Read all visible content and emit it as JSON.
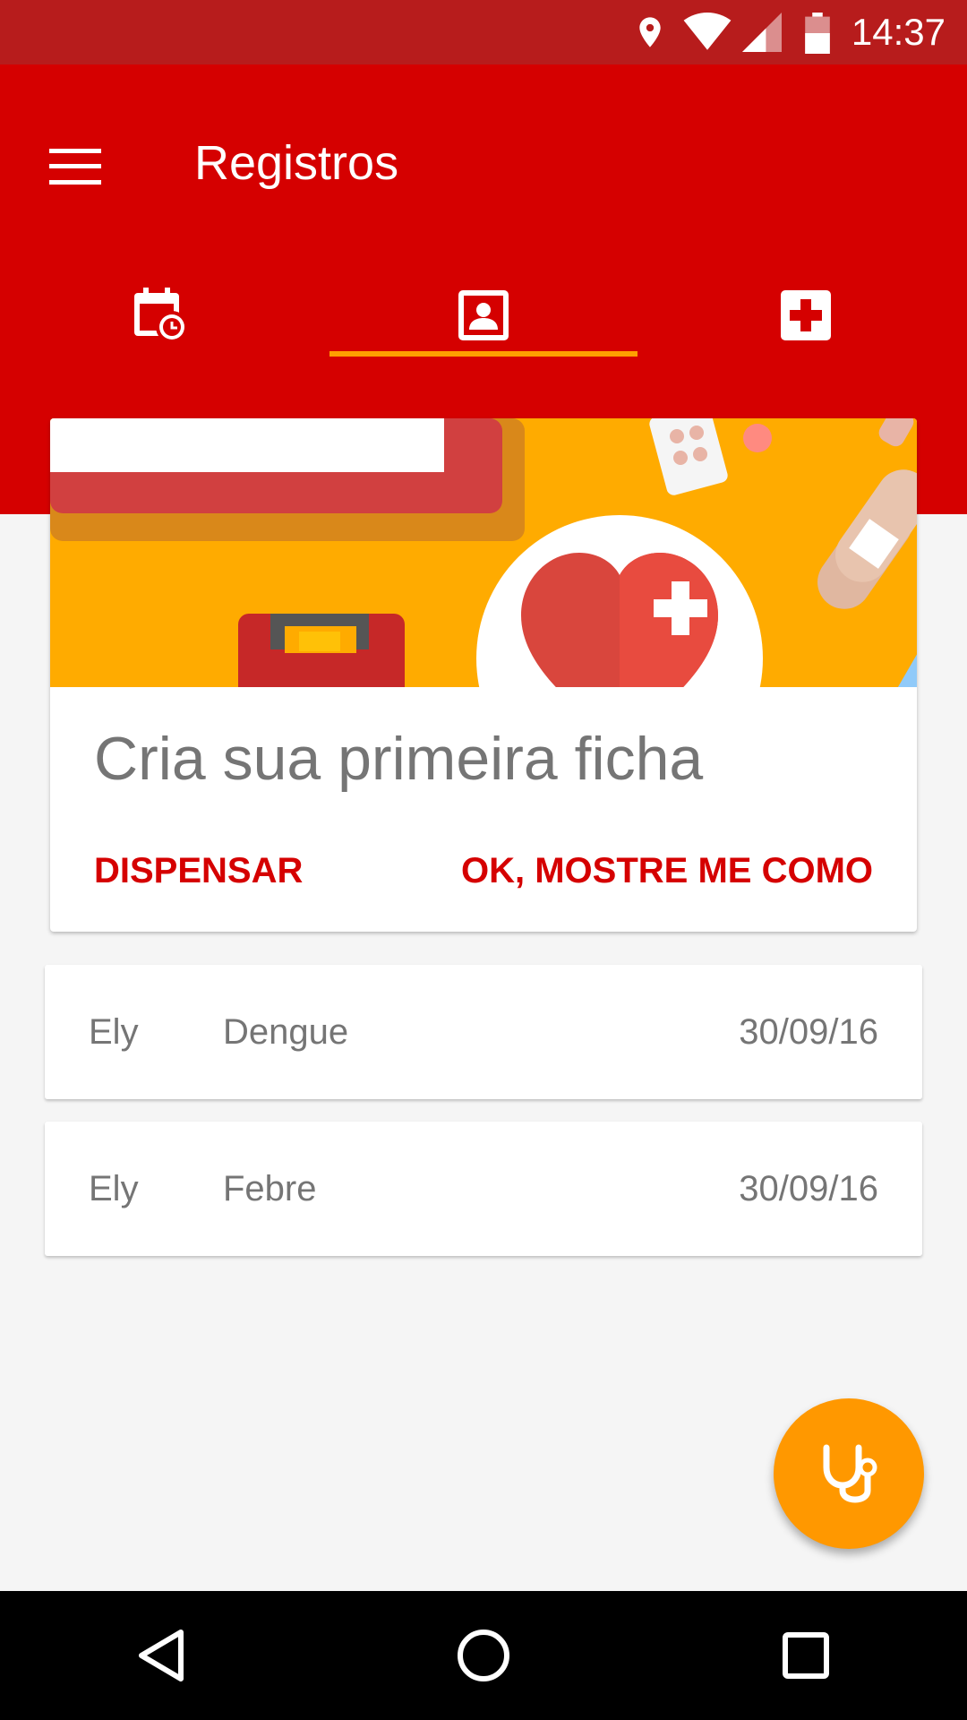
{
  "status_bar": {
    "time": "14:37",
    "icons": [
      "location-icon",
      "wifi-icon",
      "cell-signal-icon",
      "battery-icon"
    ]
  },
  "app_bar": {
    "title": "Registros",
    "menu_icon": "hamburger-menu-icon",
    "tabs": [
      {
        "icon": "calendar-clock-icon",
        "active": false
      },
      {
        "icon": "contact-card-icon",
        "active": true
      },
      {
        "icon": "medical-cross-icon",
        "active": false
      }
    ],
    "background": "#d50000",
    "indicator_color": "#ffa000"
  },
  "onboarding_card": {
    "title": "Cria sua primeira ficha",
    "dismiss_label": "DISPENSAR",
    "confirm_label": "OK, MOSTRE ME COMO"
  },
  "records": [
    {
      "name": "Ely",
      "illness": "Dengue",
      "date": "30/09/16"
    },
    {
      "name": "Ely",
      "illness": "Febre",
      "date": "30/09/16"
    }
  ],
  "fab": {
    "icon": "stethoscope-icon",
    "color": "#ff9800"
  },
  "nav_bar": {
    "buttons": [
      "back-icon",
      "home-icon",
      "recents-icon"
    ]
  }
}
